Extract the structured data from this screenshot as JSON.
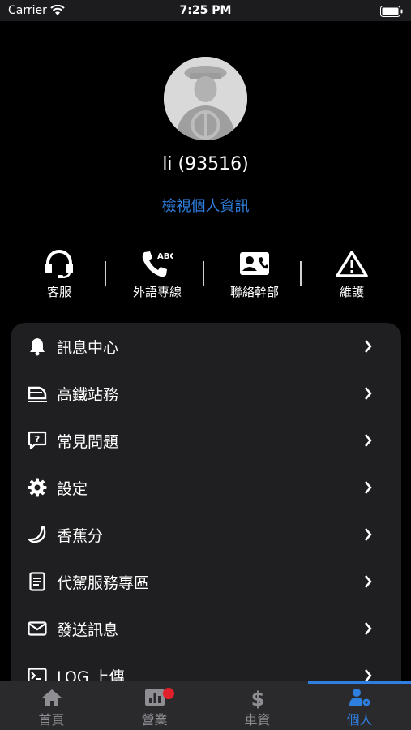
{
  "status_bar": {
    "carrier": "Carrier",
    "time": "7:25 PM"
  },
  "profile": {
    "name": "li (93516)",
    "view_profile_link": "檢視個人資訊"
  },
  "quick_actions": [
    {
      "label": "客服",
      "icon": "headset-icon"
    },
    {
      "label": "外語專線",
      "icon": "phone-abc-icon"
    },
    {
      "label": "聯絡幹部",
      "icon": "contact-card-icon"
    },
    {
      "label": "維護",
      "icon": "warning-icon"
    }
  ],
  "menu": {
    "items": [
      {
        "label": "訊息中心",
        "icon": "bell-icon"
      },
      {
        "label": "高鐵站務",
        "icon": "train-icon"
      },
      {
        "label": "常見問題",
        "icon": "question-bubble-icon"
      },
      {
        "label": "設定",
        "icon": "gear-icon"
      },
      {
        "label": "香蕉分",
        "icon": "banana-icon"
      },
      {
        "label": "代駕服務專區",
        "icon": "document-icon"
      },
      {
        "label": "發送訊息",
        "icon": "envelope-icon"
      },
      {
        "label": "LOG 上傳",
        "icon": "terminal-icon"
      }
    ]
  },
  "tab_bar": {
    "tabs": [
      {
        "label": "首頁",
        "icon": "home-icon"
      },
      {
        "label": "營業",
        "icon": "chart-icon",
        "has_badge": true
      },
      {
        "label": "車資",
        "icon": "dollar-icon"
      },
      {
        "label": "個人",
        "icon": "user-gear-icon",
        "active": true
      }
    ]
  },
  "colors": {
    "accent": "#2f7fe0",
    "background": "#000000",
    "card": "#1f1f21",
    "badge": "#e0202a"
  }
}
